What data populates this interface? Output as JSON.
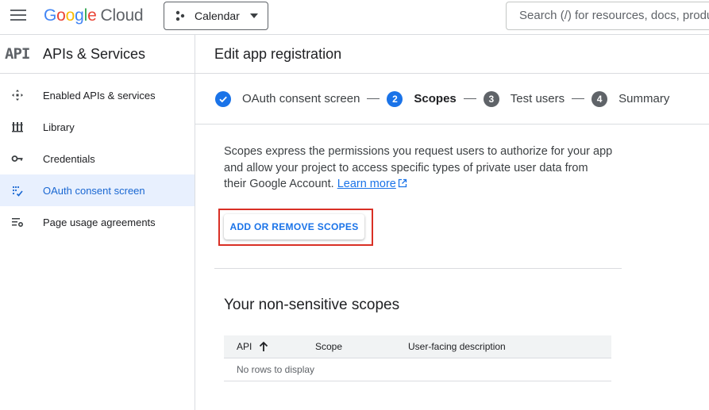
{
  "topbar": {
    "logo_parts": [
      "G",
      "o",
      "o",
      "g",
      "l",
      "e"
    ],
    "logo_cloud": "Cloud",
    "project": "Calendar",
    "search_placeholder": "Search (/) for resources, docs, products, and more"
  },
  "sidebar": {
    "api_logo": "API",
    "title": "APIs & Services",
    "items": [
      {
        "label": "Enabled APIs & services",
        "icon": "enabled-apis-icon",
        "active": false
      },
      {
        "label": "Library",
        "icon": "library-icon",
        "active": false
      },
      {
        "label": "Credentials",
        "icon": "key-icon",
        "active": false
      },
      {
        "label": "OAuth consent screen",
        "icon": "oauth-consent-icon",
        "active": true
      },
      {
        "label": "Page usage agreements",
        "icon": "settings-list-icon",
        "active": false
      }
    ]
  },
  "main": {
    "title": "Edit app registration",
    "steps": [
      {
        "number": "",
        "label": "OAuth consent screen",
        "state": "done"
      },
      {
        "number": "2",
        "label": "Scopes",
        "state": "current"
      },
      {
        "number": "3",
        "label": "Test users",
        "state": "todo"
      },
      {
        "number": "4",
        "label": "Summary",
        "state": "todo"
      }
    ],
    "description": "Scopes express the permissions you request users to authorize for your app and allow your project to access specific types of private user data from their Google Account.",
    "learn_more": "Learn more",
    "add_scopes_button": "ADD OR REMOVE SCOPES",
    "section_title": "Your non-sensitive scopes",
    "table": {
      "columns": [
        "API",
        "Scope",
        "User-facing description"
      ],
      "empty_text": "No rows to display"
    }
  },
  "colors": {
    "accent": "#1a73e8",
    "active_bg": "#e8f0fe",
    "highlight": "#d93025"
  }
}
